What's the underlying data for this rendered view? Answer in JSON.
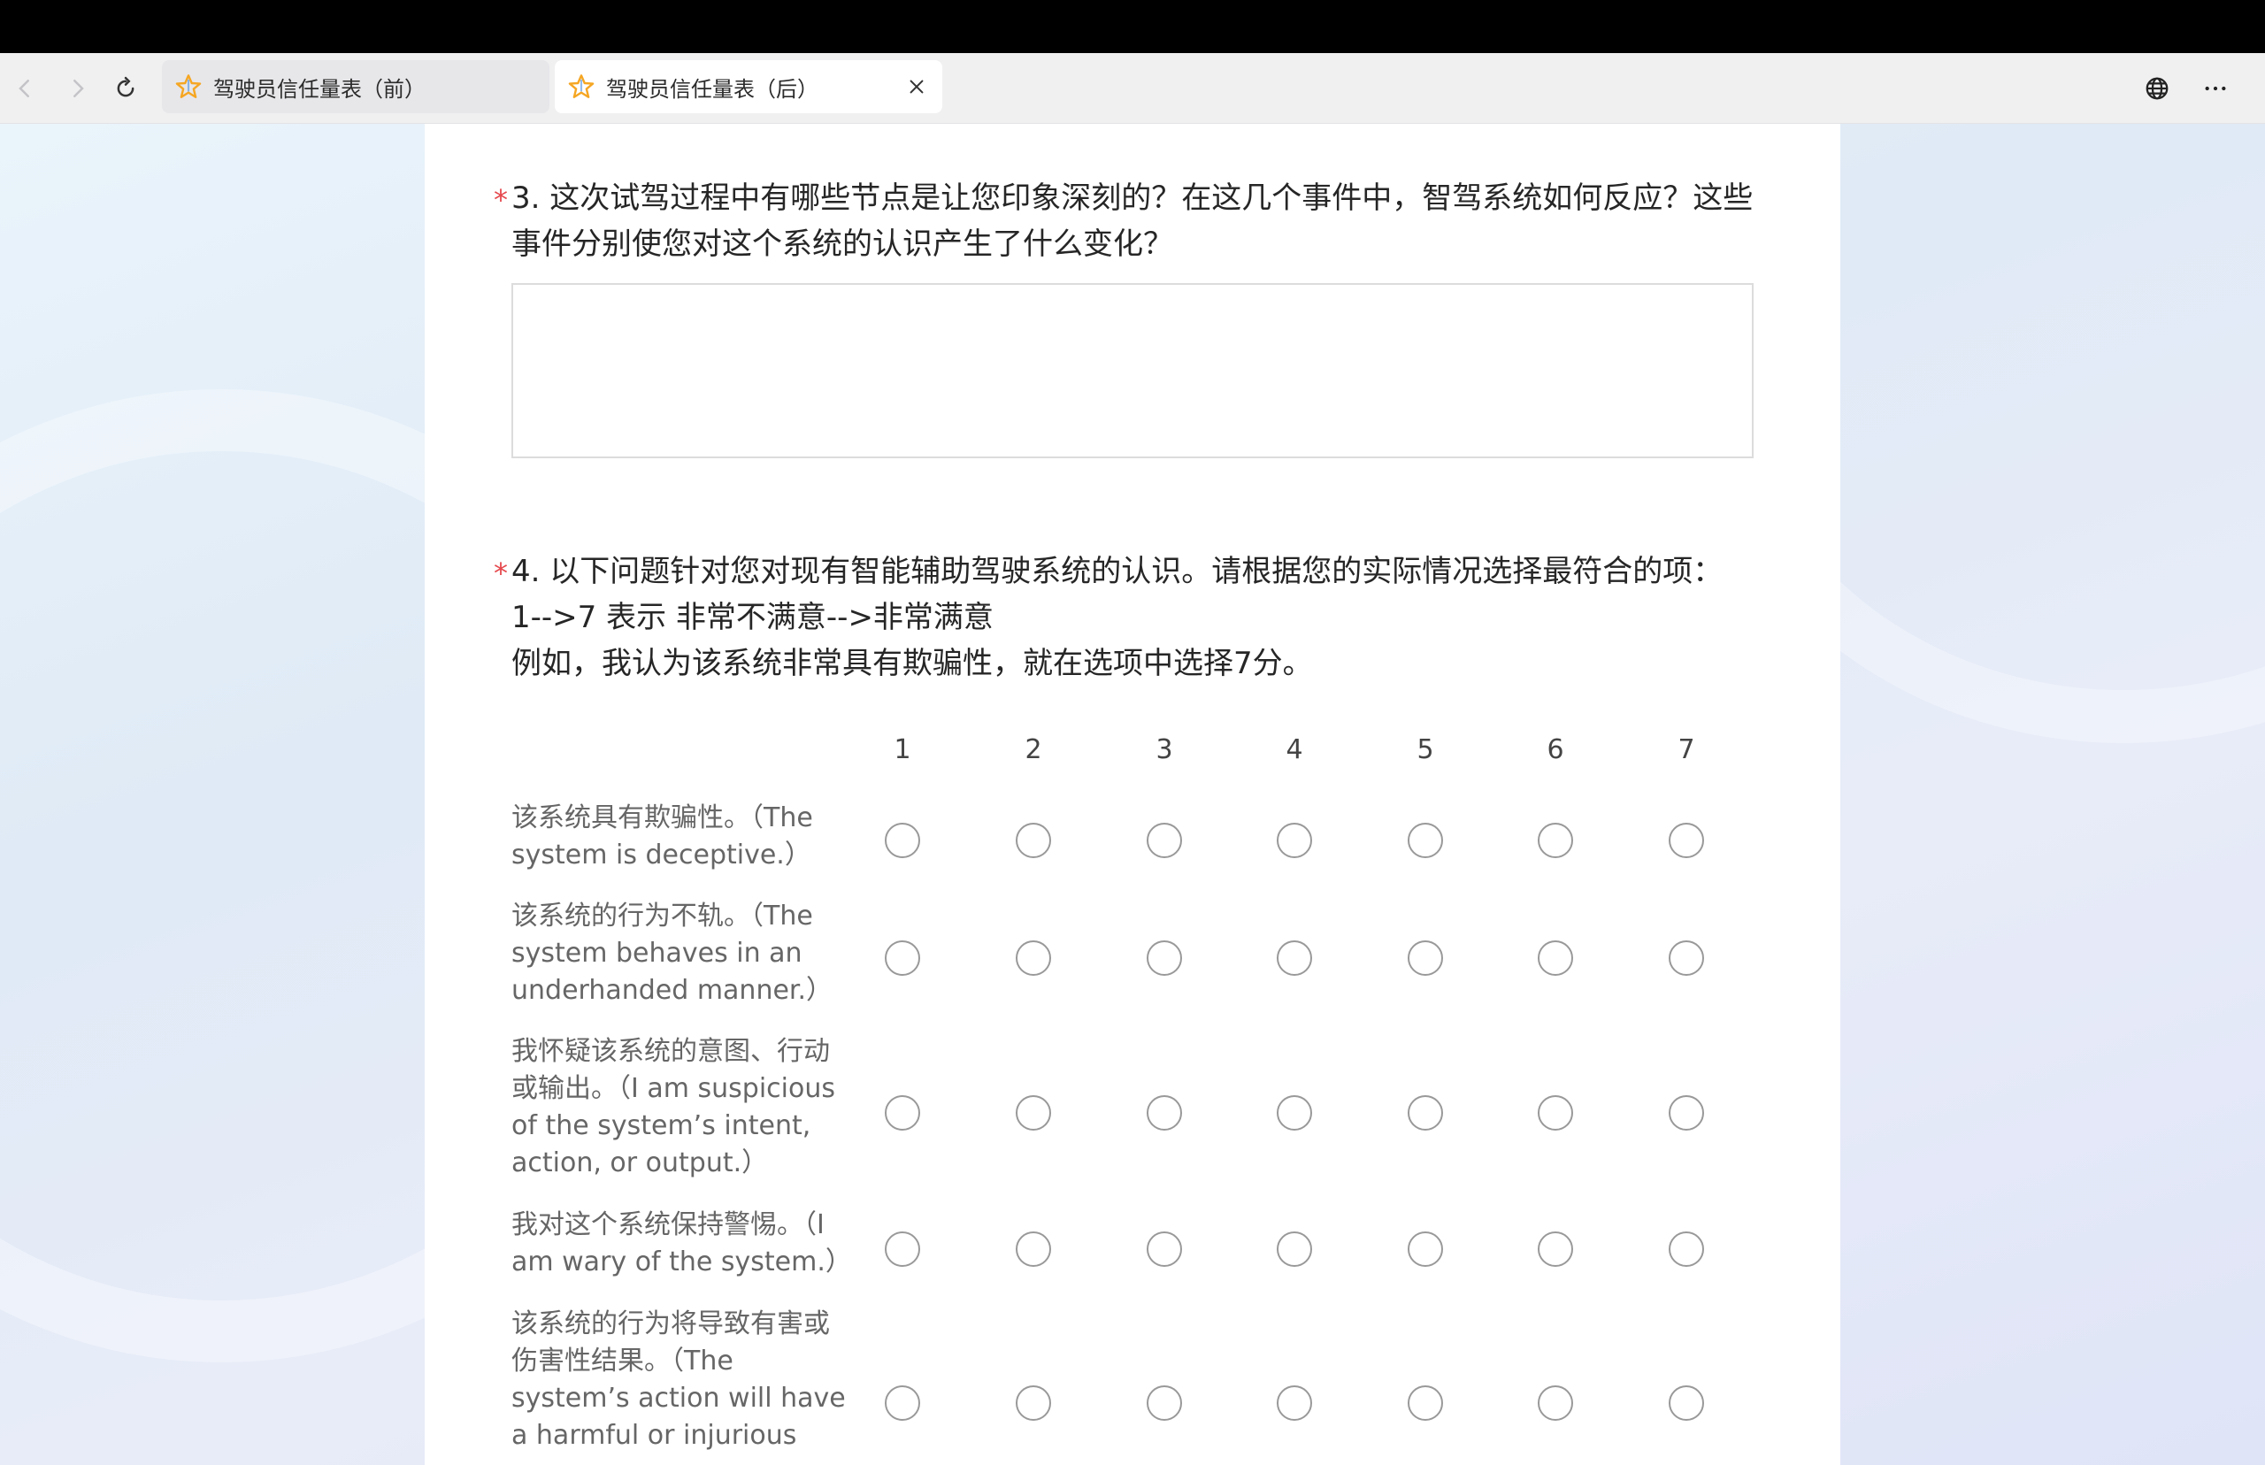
{
  "browser": {
    "tabs": [
      {
        "label": "驾驶员信任量表（前）",
        "active": false
      },
      {
        "label": "驾驶员信任量表（后）",
        "active": true
      }
    ],
    "icons": {
      "back": "arrow-left-icon",
      "forward": "arrow-right-icon",
      "reload": "reload-icon",
      "tab_icon": "star-icon",
      "close": "close-icon",
      "language": "globe-icon",
      "more": "more-icon"
    }
  },
  "question3": {
    "required_mark": "*",
    "line1": "3. 这次试驾过程中有哪些节点是让您印象深刻的？在这几个事件中，智驾系统如何反应？这些",
    "line2": "事件分别使您对这个系统的认识产生了什么变化？",
    "answer_value": ""
  },
  "question4": {
    "required_mark": "*",
    "line1": "4. 以下问题针对您对现有智能辅助驾驶系统的认识。请根据您的实际情况选择最符合的项：",
    "line2": "1-->7 表示 非常不满意-->非常满意",
    "line3": "例如，我认为该系统非常具有欺骗性，就在选项中选择7分。",
    "scale": [
      "1",
      "2",
      "3",
      "4",
      "5",
      "6",
      "7"
    ],
    "rows": [
      {
        "lines": [
          "该系统具有欺骗性。（The",
          "system is deceptive.）"
        ],
        "selected": null
      },
      {
        "lines": [
          "该系统的行为不轨。（The",
          "system behaves in an",
          "underhanded manner.）"
        ],
        "selected": null
      },
      {
        "lines": [
          "我怀疑该系统的意图、行动",
          "或输出。（I am suspicious",
          "of the system’s intent,",
          "action, or output.）"
        ],
        "selected": null
      },
      {
        "lines": [
          "我对这个系统保持警惕。（I",
          "am wary of the system.）"
        ],
        "selected": null
      },
      {
        "lines": [
          "该系统的行为将导致有害或",
          "伤害性结果。（The",
          "system’s action will have",
          "a harmful or injurious"
        ],
        "selected": null
      }
    ]
  },
  "colors": {
    "required": "#e5484d",
    "radio_border": "#999999",
    "tab_star": "#f5a623"
  }
}
